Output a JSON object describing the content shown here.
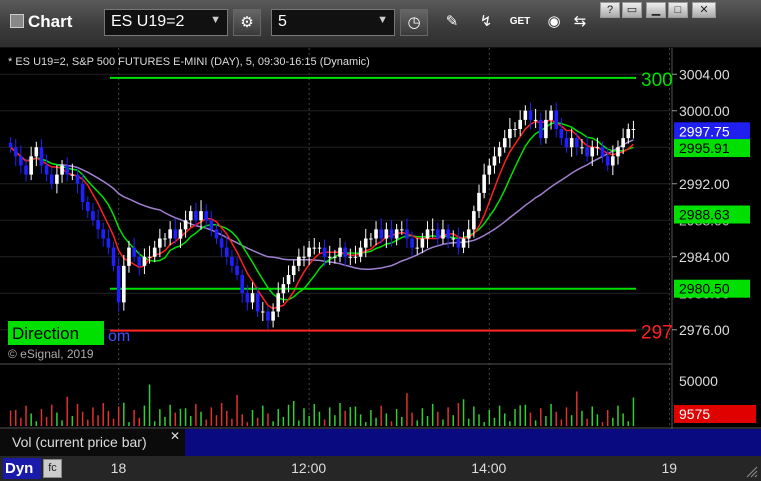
{
  "app": {
    "title": "Chart"
  },
  "toolbar": {
    "symbol_value": "ES U19=2",
    "interval_value": "5",
    "get_label": "GET"
  },
  "chart": {
    "info_text": "* ES U19=2, S&P 500 FUTURES E-MINI (DAY), 5, 09:30-16:15 (Dynamic)",
    "watermark": "© eSignal, 2019",
    "direction_label": "Direction",
    "om_text": "om",
    "right_edge_top": "300",
    "right_edge_bottom": "297",
    "price_ticks": [
      "3004.00",
      "3000.00",
      "2992.00",
      "2984.00",
      "2976.00"
    ],
    "price_tick_values": [
      3004,
      3000,
      2992,
      2984,
      2976
    ],
    "partial_ticks": [
      "2996.00",
      "2988.00",
      "2980.00"
    ],
    "partial_tick_values": [
      2996,
      2988,
      2980
    ],
    "badges": [
      {
        "text": "2997.75",
        "value": 2997.75,
        "color": "#1f1ff0",
        "fg": "#ffffff"
      },
      {
        "text": "2995.91",
        "value": 2995.91,
        "color": "#00e000",
        "fg": "#000000"
      },
      {
        "text": "2988.63",
        "value": 2988.63,
        "color": "#00e000",
        "fg": "#000000"
      },
      {
        "text": "2980.50",
        "value": 2980.5,
        "color": "#00e000",
        "fg": "#000000"
      }
    ],
    "levels": [
      {
        "value": 3003.6,
        "color": "#00e000"
      },
      {
        "value": 2980.5,
        "color": "#00e000"
      },
      {
        "value": 2975.9,
        "color": "#ff2020"
      }
    ],
    "volume": {
      "tick": "50000",
      "tick_value": 50000,
      "badge": "9575",
      "badge_value": 9575,
      "badge_color": "#e00000",
      "pane_label": "Vol (current price bar)"
    },
    "time_labels": [
      {
        "text": "18",
        "bar": 21
      },
      {
        "text": "12:00",
        "bar": 58
      },
      {
        "text": "14:00",
        "bar": 93
      },
      {
        "text": "19",
        "bar": 128
      }
    ],
    "colors": {
      "up": "#ffffff",
      "down": "#2020ff",
      "ma_red": "#ff2020",
      "ma_green": "#00e000",
      "ma_purple": "#a080d0",
      "grid": "#444444"
    }
  },
  "chart_data": {
    "type": "candlestick",
    "title": "* ES U19=2, S&P 500 FUTURES E-MINI (DAY), 5, 09:30-16:15 (Dynamic)",
    "ylim": [
      2974,
      3006
    ],
    "closes": [
      2996,
      2995,
      2994,
      2993,
      2995,
      2996,
      2994,
      2993,
      2992,
      2993,
      2994,
      2993,
      2993,
      2992,
      2990,
      2989,
      2988,
      2987,
      2986,
      2985,
      2983,
      2979,
      2983,
      2985,
      2984,
      2983,
      2984,
      2984,
      2985,
      2986,
      2986,
      2987,
      2986,
      2987,
      2988,
      2989,
      2988,
      2989,
      2988,
      2987,
      2986,
      2985,
      2984,
      2983,
      2982,
      2980,
      2979,
      2980,
      2978,
      2978,
      2977,
      2978,
      2980,
      2981,
      2982,
      2983,
      2984,
      2984,
      2985,
      2985,
      2985,
      2984,
      2984,
      2984,
      2985,
      2984,
      2984,
      2984,
      2985,
      2986,
      2986,
      2987,
      2986,
      2987,
      2986,
      2987,
      2987,
      2986,
      2985,
      2985,
      2986,
      2987,
      2987,
      2986,
      2987,
      2986,
      2986,
      2985,
      2986,
      2987,
      2989,
      2991,
      2993,
      2994,
      2995,
      2996,
      2997,
      2998,
      2998,
      2999,
      3000,
      2999,
      2999,
      2997,
      2999,
      3000,
      2998,
      2997,
      2996,
      2997,
      2996,
      2996,
      2995,
      2996,
      2996,
      2995,
      2994,
      2995,
      2996,
      2997,
      2998,
      2998
    ],
    "volume_max_value": 50000,
    "last_volume": 9575
  }
}
